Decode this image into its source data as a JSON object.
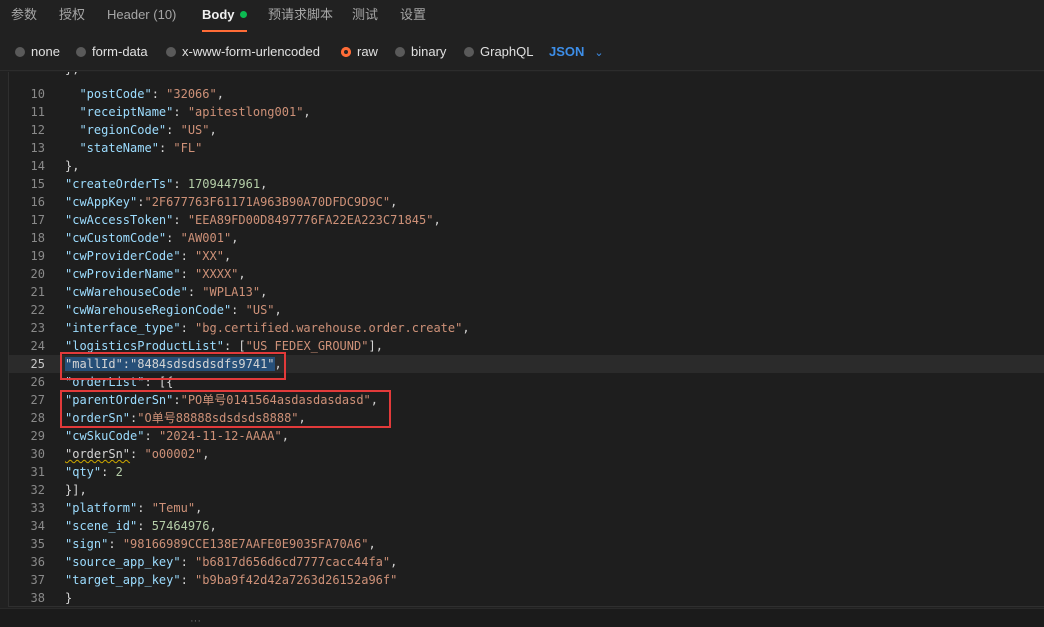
{
  "tabs": [
    {
      "label": "参数"
    },
    {
      "label": "授权"
    },
    {
      "label": "Header",
      "count": "(10)"
    },
    {
      "label": "Body"
    },
    {
      "label": "预请求脚本"
    },
    {
      "label": "测试"
    },
    {
      "label": "设置"
    }
  ],
  "body_modes": [
    {
      "label": "none",
      "selected": false
    },
    {
      "label": "form-data",
      "selected": false
    },
    {
      "label": "x-www-form-urlencoded",
      "selected": false
    },
    {
      "label": "raw",
      "selected": true
    },
    {
      "label": "binary",
      "selected": false
    },
    {
      "label": "GraphQL",
      "selected": false
    }
  ],
  "raw_format": "JSON",
  "colors": {
    "accent": "#ff6c37",
    "active_dot": "#0cbb52",
    "format_link": "#3d8ee8",
    "highlight_box": "#e23a3a"
  },
  "editor": {
    "partial_top": "},",
    "lines": [
      {
        "n": "10",
        "tokens": [
          [
            "p",
            "  "
          ],
          [
            "k",
            "\"postCode\""
          ],
          [
            "p",
            ": "
          ],
          [
            "s",
            "\"32066\""
          ],
          [
            "p",
            ","
          ]
        ]
      },
      {
        "n": "11",
        "tokens": [
          [
            "p",
            "  "
          ],
          [
            "k",
            "\"receiptName\""
          ],
          [
            "p",
            ": "
          ],
          [
            "s",
            "\"apitestlong001\""
          ],
          [
            "p",
            ","
          ]
        ]
      },
      {
        "n": "12",
        "tokens": [
          [
            "p",
            "  "
          ],
          [
            "k",
            "\"regionCode\""
          ],
          [
            "p",
            ": "
          ],
          [
            "s",
            "\"US\""
          ],
          [
            "p",
            ","
          ]
        ]
      },
      {
        "n": "13",
        "tokens": [
          [
            "p",
            "  "
          ],
          [
            "k",
            "\"stateName\""
          ],
          [
            "p",
            ": "
          ],
          [
            "s",
            "\"FL\""
          ]
        ]
      },
      {
        "n": "14",
        "tokens": [
          [
            "p",
            "},"
          ]
        ]
      },
      {
        "n": "15",
        "tokens": [
          [
            "k",
            "\"createOrderTs\""
          ],
          [
            "p",
            ": "
          ],
          [
            "n",
            "1709447961"
          ],
          [
            "p",
            ","
          ]
        ]
      },
      {
        "n": "16",
        "tokens": [
          [
            "k",
            "\"cwAppKey\""
          ],
          [
            "p",
            ":"
          ],
          [
            "s",
            "\"2F677763F61171A963B90A70DFDC9D9C\""
          ],
          [
            "p",
            ","
          ]
        ]
      },
      {
        "n": "17",
        "tokens": [
          [
            "k",
            "\"cwAccessToken\""
          ],
          [
            "p",
            ": "
          ],
          [
            "s",
            "\"EEA89FD00D8497776FA22EA223C71845\""
          ],
          [
            "p",
            ","
          ]
        ]
      },
      {
        "n": "18",
        "tokens": [
          [
            "k",
            "\"cwCustomCode\""
          ],
          [
            "p",
            ": "
          ],
          [
            "s",
            "\"AW001\""
          ],
          [
            "p",
            ","
          ]
        ]
      },
      {
        "n": "19",
        "tokens": [
          [
            "k",
            "\"cwProviderCode\""
          ],
          [
            "p",
            ": "
          ],
          [
            "s",
            "\"XX\""
          ],
          [
            "p",
            ","
          ]
        ]
      },
      {
        "n": "20",
        "tokens": [
          [
            "k",
            "\"cwProviderName\""
          ],
          [
            "p",
            ": "
          ],
          [
            "s",
            "\"XXXX\""
          ],
          [
            "p",
            ","
          ]
        ]
      },
      {
        "n": "21",
        "tokens": [
          [
            "k",
            "\"cwWarehouseCode\""
          ],
          [
            "p",
            ": "
          ],
          [
            "s",
            "\"WPLA13\""
          ],
          [
            "p",
            ","
          ]
        ]
      },
      {
        "n": "22",
        "tokens": [
          [
            "k",
            "\"cwWarehouseRegionCode\""
          ],
          [
            "p",
            ": "
          ],
          [
            "s",
            "\"US\""
          ],
          [
            "p",
            ","
          ]
        ]
      },
      {
        "n": "23",
        "tokens": [
          [
            "k",
            "\"interface_type\""
          ],
          [
            "p",
            ": "
          ],
          [
            "s",
            "\"bg.certified.warehouse.order.create\""
          ],
          [
            "p",
            ","
          ]
        ]
      },
      {
        "n": "24",
        "tokens": [
          [
            "k",
            "\"logisticsProductList\""
          ],
          [
            "p",
            ": ["
          ],
          [
            "s",
            "\"US_FEDEX_GROUND\""
          ],
          [
            "p",
            "],"
          ]
        ]
      },
      {
        "n": "25",
        "current": true,
        "tokens": [
          [
            "sel",
            "\"mallId\":\"8484sdsdsdsdfs9741\""
          ],
          [
            "p",
            ","
          ]
        ]
      },
      {
        "n": "26",
        "tokens": [
          [
            "k",
            "\"orderList\""
          ],
          [
            "p",
            ": [{"
          ]
        ]
      },
      {
        "n": "27",
        "tokens": [
          [
            "k",
            "\"parentOrderSn\""
          ],
          [
            "p",
            ":"
          ],
          [
            "s",
            "\"PO单号0141564asdasdasdasd\""
          ],
          [
            "p",
            ","
          ]
        ]
      },
      {
        "n": "28",
        "tokens": [
          [
            "k",
            "\"orderSn\""
          ],
          [
            "p",
            ":"
          ],
          [
            "s",
            "\"O单号88888sdsdsds8888\""
          ],
          [
            "p",
            ","
          ]
        ]
      },
      {
        "n": "29",
        "tokens": [
          [
            "k",
            "\"cwSkuCode\""
          ],
          [
            "p",
            ": "
          ],
          [
            "s",
            "\"2024-11-12-AAAA\""
          ],
          [
            "p",
            ","
          ]
        ]
      },
      {
        "n": "30",
        "tokens": [
          [
            "squig",
            "\"orderSn\""
          ],
          [
            "p",
            ": "
          ],
          [
            "s",
            "\"o00002\""
          ],
          [
            "p",
            ","
          ]
        ]
      },
      {
        "n": "31",
        "tokens": [
          [
            "k",
            "\"qty\""
          ],
          [
            "p",
            ": "
          ],
          [
            "n",
            "2"
          ]
        ]
      },
      {
        "n": "32",
        "tokens": [
          [
            "p",
            "}],"
          ]
        ]
      },
      {
        "n": "33",
        "tokens": [
          [
            "k",
            "\"platform\""
          ],
          [
            "p",
            ": "
          ],
          [
            "s",
            "\"Temu\""
          ],
          [
            "p",
            ","
          ]
        ]
      },
      {
        "n": "34",
        "tokens": [
          [
            "k",
            "\"scene_id\""
          ],
          [
            "p",
            ": "
          ],
          [
            "n",
            "57464976"
          ],
          [
            "p",
            ","
          ]
        ]
      },
      {
        "n": "35",
        "tokens": [
          [
            "k",
            "\"sign\""
          ],
          [
            "p",
            ": "
          ],
          [
            "s",
            "\"98166989CCE138E7AAFE0E9035FA70A6\""
          ],
          [
            "p",
            ","
          ]
        ]
      },
      {
        "n": "36",
        "tokens": [
          [
            "k",
            "\"source_app_key\""
          ],
          [
            "p",
            ": "
          ],
          [
            "s",
            "\"b6817d656d6cd7777cacc44fa\""
          ],
          [
            "p",
            ","
          ]
        ]
      },
      {
        "n": "37",
        "tokens": [
          [
            "k",
            "\"target_app_key\""
          ],
          [
            "p",
            ": "
          ],
          [
            "s",
            "\"b9ba9f42d42a7263d26152a96f\""
          ]
        ]
      },
      {
        "n": "38",
        "tokens": [
          [
            "p",
            "}"
          ]
        ]
      }
    ]
  }
}
